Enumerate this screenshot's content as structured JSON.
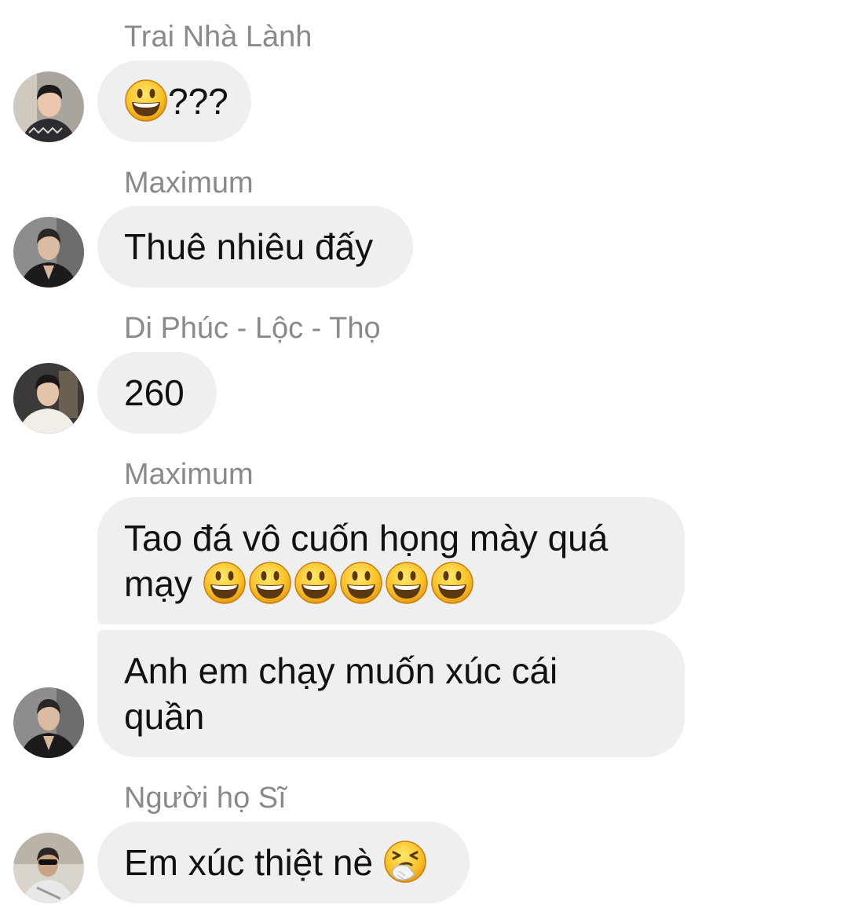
{
  "messages": [
    {
      "sender": "Trai Nhà Lành",
      "text": "???",
      "emoji_before": "grinning-face"
    },
    {
      "sender": "Maximum",
      "text": "Thuê nhiêu đấy"
    },
    {
      "sender": "Di Phúc - Lộc - Thọ",
      "text": "260"
    },
    {
      "sender": "Maximum",
      "line1": "Tao đá vô cuốn họng mày quá",
      "line2": "mạy",
      "emoji_count": 6,
      "emoji": "grinning-face"
    },
    {
      "line1": "Anh em chạy muốn xúc cái",
      "line2": "quần"
    },
    {
      "sender": "Người họ Sĩ",
      "text": "Em xúc thiệt nè",
      "emoji_after": "sneezing-face"
    }
  ],
  "colors": {
    "bubble": "#efefef",
    "sender_name": "#8a8a8a",
    "text": "#111111",
    "emoji_yellow": "#f8c025"
  }
}
